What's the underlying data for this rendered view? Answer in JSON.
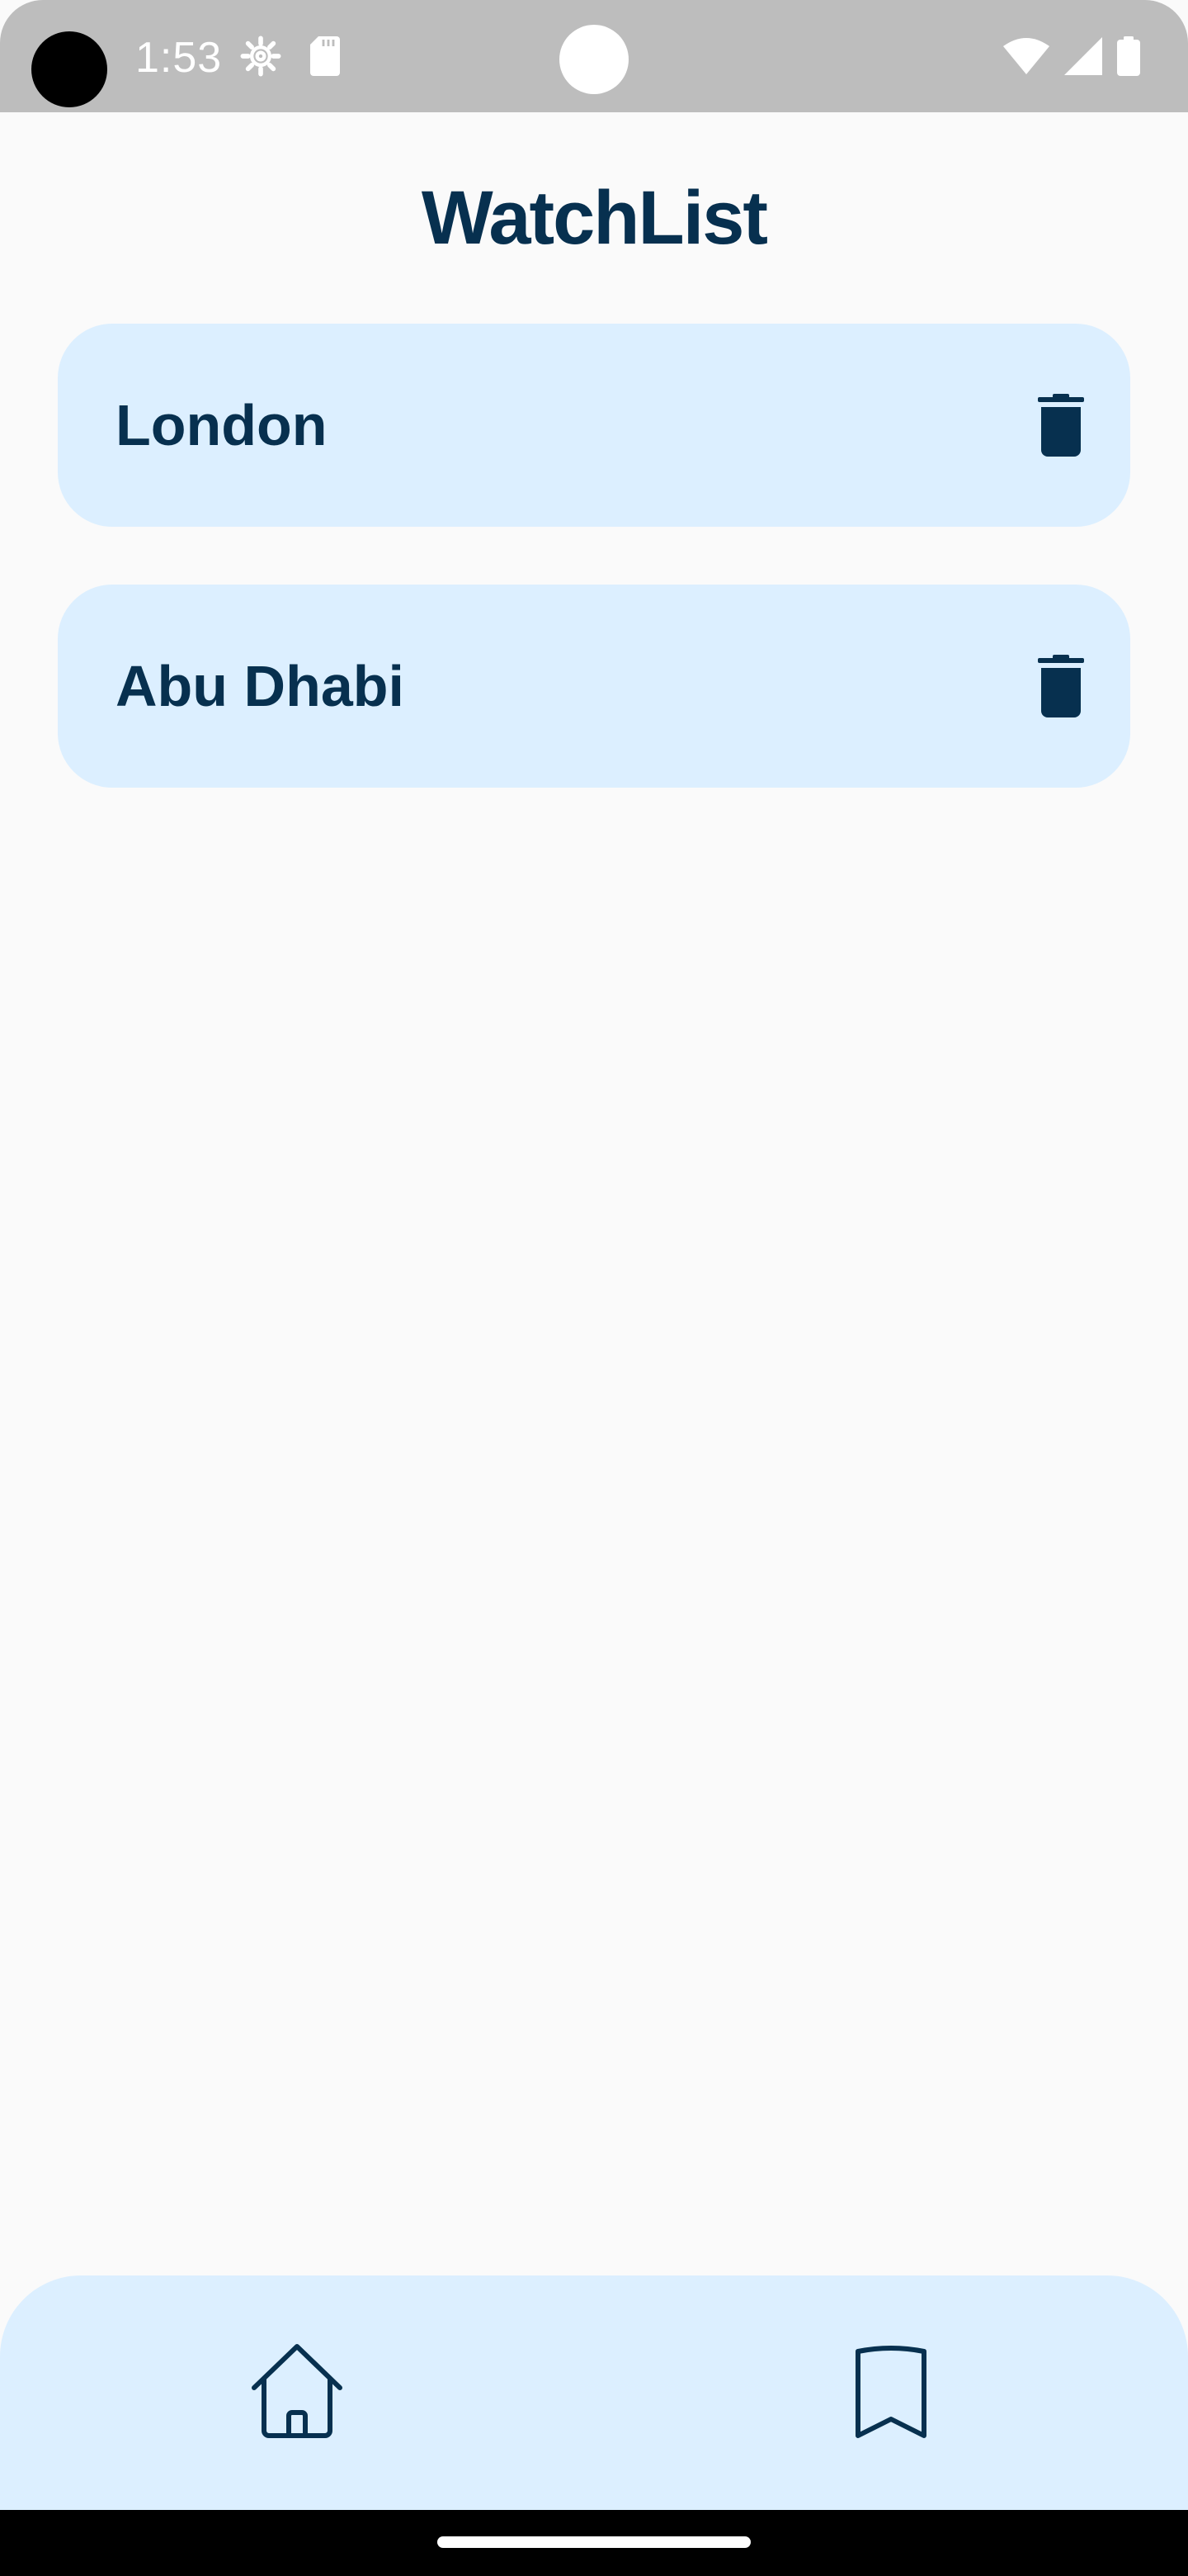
{
  "status_bar": {
    "time": "1:53",
    "icons": [
      "settings-gear-icon",
      "sd-card-icon",
      "wifi-icon",
      "cellular-signal-icon",
      "battery-icon"
    ]
  },
  "header": {
    "title": "WatchList"
  },
  "watchlist": {
    "items": [
      {
        "label": "London",
        "action_icon": "trash-icon"
      },
      {
        "label": "Abu Dhabi",
        "action_icon": "trash-icon"
      }
    ]
  },
  "bottom_nav": {
    "items": [
      {
        "icon": "home-icon"
      },
      {
        "icon": "bookmark-icon"
      }
    ]
  },
  "colors": {
    "primary": "#07304f",
    "card_bg": "#dcefff",
    "page_bg": "#fafafa",
    "status_bar_bg": "#bdbdbd"
  }
}
